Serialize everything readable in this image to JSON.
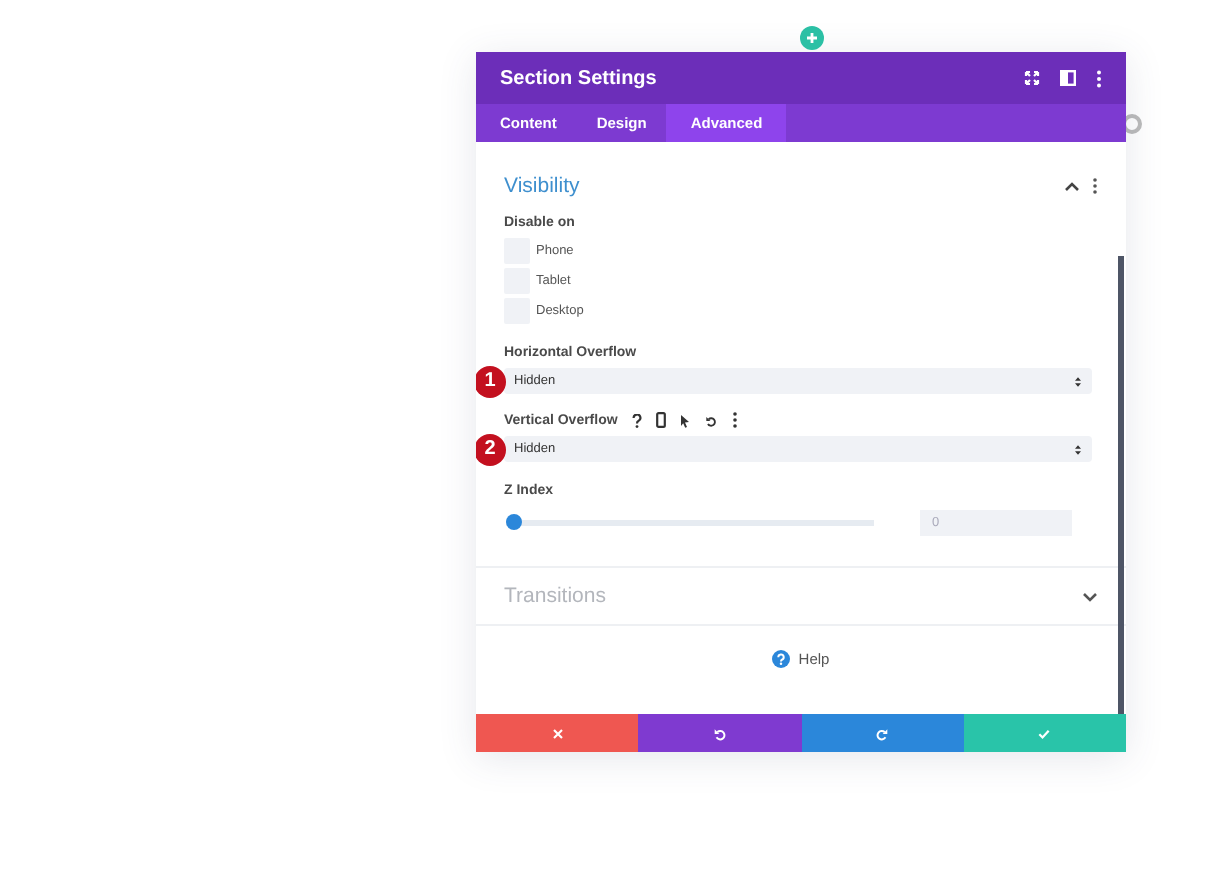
{
  "panel": {
    "title": "Section Settings"
  },
  "tabs": [
    {
      "label": "Content",
      "selected": false
    },
    {
      "label": "Design",
      "selected": false
    },
    {
      "label": "Advanced",
      "selected": true
    }
  ],
  "sections": [
    {
      "title": "Visibility",
      "expanded": true,
      "fields": [
        {
          "kind": "checkboxes",
          "label": "Disable on",
          "options": [
            {
              "label": "Phone",
              "checked": false
            },
            {
              "label": "Tablet",
              "checked": false
            },
            {
              "label": "Desktop",
              "checked": false
            }
          ]
        },
        {
          "kind": "select",
          "label": "Horizontal Overflow",
          "value": "Hidden",
          "marker": "1",
          "show_tools": false
        },
        {
          "kind": "select",
          "label": "Vertical Overflow",
          "value": "Hidden",
          "marker": "2",
          "show_tools": true
        },
        {
          "kind": "range",
          "label": "Z Index",
          "level": 0,
          "placeholder": "0"
        }
      ]
    },
    {
      "title": "Transitions",
      "expanded": false
    }
  ],
  "help": "Help",
  "footer_buttons": [
    {
      "kind": "cancel"
    },
    {
      "kind": "undo"
    },
    {
      "kind": "redo"
    },
    {
      "kind": "save"
    }
  ]
}
